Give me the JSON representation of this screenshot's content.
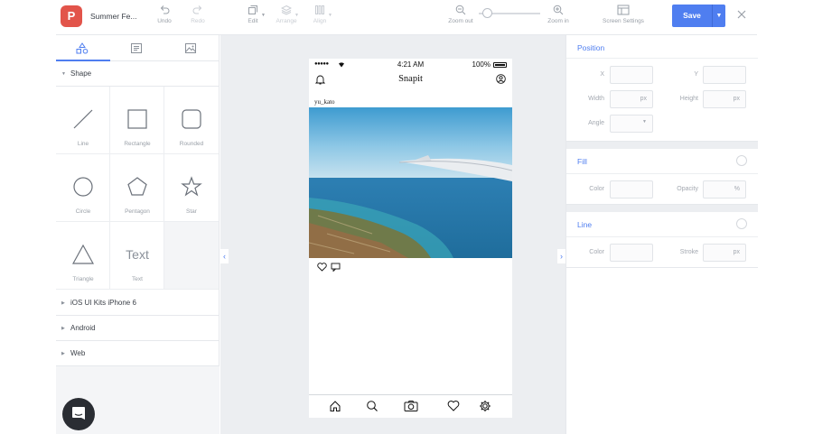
{
  "project": {
    "name": "Summer Fe...",
    "logo_letter": "P"
  },
  "toolbar": {
    "undo": "Undo",
    "redo": "Redo",
    "edit": "Edit",
    "arrange": "Arrange",
    "align": "Align",
    "zoom_out": "Zoom out",
    "zoom_in": "Zoom in",
    "screen_settings": "Screen Settings",
    "save_label": "Save"
  },
  "left_panel": {
    "shape_section": "Shape",
    "shapes": [
      "Line",
      "Rectangle",
      "Rounded",
      "Circle",
      "Pentagon",
      "Star",
      "Triangle",
      "Text"
    ],
    "text_glyph": "Text",
    "kits": [
      "iOS UI Kits iPhone 6",
      "Android",
      "Web"
    ]
  },
  "phone": {
    "time": "4:21 AM",
    "battery": "100%",
    "signal": "●●●●●",
    "app_title": "Snapit",
    "username": "yu_kato"
  },
  "right_panel": {
    "position": {
      "title": "Position",
      "x": "X",
      "y": "Y",
      "width": "Width",
      "height": "Height",
      "angle": "Angle",
      "unit": "px"
    },
    "fill": {
      "title": "Fill",
      "color": "Color",
      "opacity": "Opacity",
      "unit": "%"
    },
    "line": {
      "title": "Line",
      "color": "Color",
      "stroke": "Stroke",
      "unit": "px"
    }
  },
  "colors": {
    "accent": "#4f7ef0",
    "logo": "#e2544a"
  }
}
